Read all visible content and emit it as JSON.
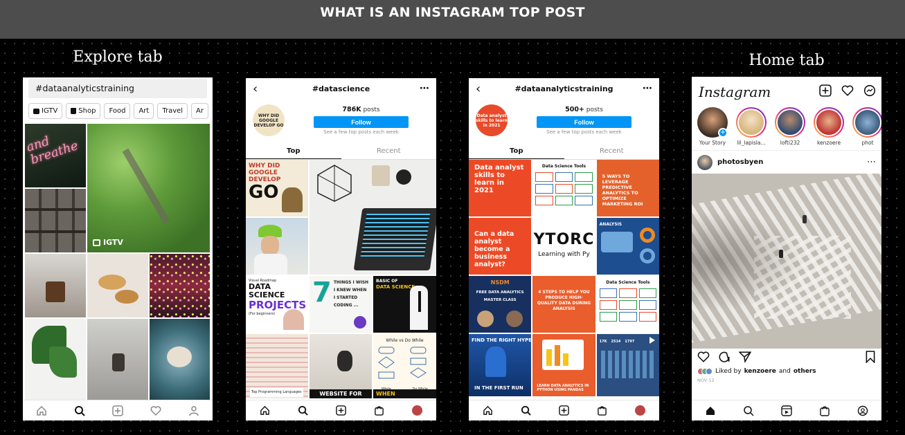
{
  "banner": {
    "title": "WHAT IS AN INSTAGRAM TOP POST"
  },
  "labels": {
    "explore": "Explore tab",
    "home": "Home tab"
  },
  "explore": {
    "search_value": "#dataanalyticstraining",
    "chips": [
      "IGTV",
      "Shop",
      "Food",
      "Art",
      "Travel",
      "Ar"
    ],
    "igtv_badge": "IGTV"
  },
  "datascience": {
    "hashtag": "#datascience",
    "posts_count": "786K",
    "posts_word": "posts",
    "follow": "Follow",
    "hint": "See a few top posts each week",
    "tab_top": "Top",
    "tab_recent": "Recent",
    "avatar_text": "WHY DID GOOGLE DEVELOP GO",
    "tiles": {
      "go_title": "WHY DID GOOGLE DEVELOP",
      "go_big": "GO",
      "projects_small": "Visual Roadmap",
      "projects_1": "DATA SCIENCE",
      "projects_2": "PROJECTS",
      "projects_sub": "(For beginners)",
      "seven": "7",
      "seven_text": "THINGS I WISH I KNEW WHEN I STARTED CODING ...",
      "basic": "BASIC OF",
      "basic_2": "DATA SCIENCE",
      "programming": "Top Programming Languages",
      "website": "WEBSITE FOR",
      "when": "WHEN",
      "while": "While vs Do While",
      "while_l": "While",
      "while_r": "Do While"
    }
  },
  "analytics": {
    "hashtag": "#dataanalyticstraining",
    "posts_count": "500+",
    "posts_word": "posts",
    "follow": "Follow",
    "hint": "See a few top posts each week",
    "tab_top": "Top",
    "tab_recent": "Recent",
    "avatar_text": "Data analyst skills to learn in 2021",
    "tiles": {
      "t1": "Data analyst skills to learn in 2021",
      "t2": "Data Science Tools",
      "t3": "5 WAYS TO LEVERAGE PREDICTIVE ANALYTICS TO OPTIMIZE MARKETING ROI",
      "t4": "Can a data analyst become a business analyst?",
      "t5_big": "YTORC",
      "t5_small": "Learning with Py",
      "t6": "ANALYSIS",
      "t7_brand": "NSDM",
      "t7": "FREE DATA ANALYTICS MASTER CLASS",
      "t8": "4 STEPS TO HELP YOU PRODUCE HIGH-QUALITY DATA DURING ANALYSIS",
      "t9": "Data Science Tools",
      "t10_top": "FIND THE RIGHT HYPERPAR",
      "t10_bottom": "IN THE FIRST RUN",
      "t11": "LEARN DATA ANALYTICS IN PYTHON USING PANDAS",
      "t12_a": "17K",
      "t12_b": "2514",
      "t12_c": "1797"
    }
  },
  "home": {
    "logo": "Instagram",
    "stories": [
      "Your Story",
      "lil_lapisla...",
      "lofti232",
      "kenzoere",
      "phot"
    ],
    "post_user": "photosbyen",
    "liked_by_prefix": "Liked by",
    "liked_by_user": "kenzoere",
    "liked_by_and": "and",
    "liked_by_others": "others",
    "date": "NOV 12"
  },
  "colors": {
    "follow_blue": "#0095f6",
    "orange": "#e8572a",
    "navy": "#1c3d7a",
    "banner_grey": "#4d4d4d"
  }
}
